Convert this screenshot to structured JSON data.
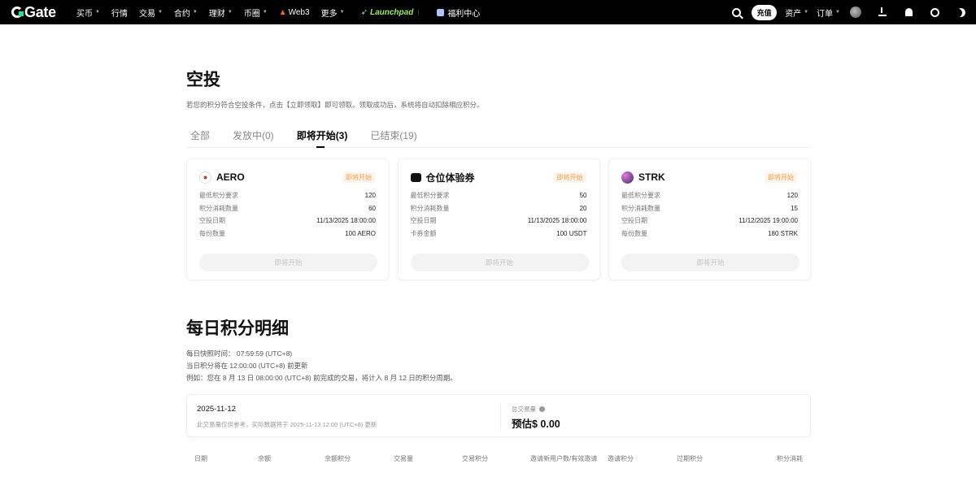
{
  "nav": {
    "logo": "Gate",
    "items": [
      {
        "label": "买币",
        "caret": true
      },
      {
        "label": "行情",
        "caret": false
      },
      {
        "label": "交易",
        "caret": true
      },
      {
        "label": "合约",
        "caret": true
      },
      {
        "label": "理财",
        "caret": true
      },
      {
        "label": "币圈",
        "caret": true
      },
      {
        "label": "Web3",
        "caret": false
      },
      {
        "label": "更多",
        "caret": true
      },
      {
        "label": "Launchpad",
        "caret": false
      },
      {
        "label": "福利中心",
        "caret": false
      }
    ],
    "deposit": "充值",
    "assets": "资产",
    "orders": "订单"
  },
  "page": {
    "title": "空投",
    "description": "若您的积分符合空投条件，点击【立即领取】即可领取。领取成功后，系统将自动扣除相应积分。",
    "tabs": [
      "全部",
      "发放中(0)",
      "即将开始(3)",
      "已结束(19)"
    ],
    "active_tab": 2
  },
  "cards": [
    {
      "name": "AERO",
      "badge": "即将开始",
      "rows": [
        {
          "k": "最低积分要求",
          "v": "120"
        },
        {
          "k": "积分消耗数量",
          "v": "60"
        },
        {
          "k": "空投日期",
          "v": "11/13/2025 18:00:00"
        },
        {
          "k": "每份数量",
          "v": "100 AERO"
        }
      ],
      "button": "即将开始"
    },
    {
      "name": "仓位体验券",
      "badge": "即将开始",
      "rows": [
        {
          "k": "最低积分要求",
          "v": "50"
        },
        {
          "k": "积分消耗数量",
          "v": "20"
        },
        {
          "k": "空投日期",
          "v": "11/13/2025 18:00:00"
        },
        {
          "k": "卡券金额",
          "v": "100 USDT"
        }
      ],
      "button": "即将开始"
    },
    {
      "name": "STRK",
      "badge": "即将开始",
      "rows": [
        {
          "k": "最低积分要求",
          "v": "120"
        },
        {
          "k": "积分消耗数量",
          "v": "15"
        },
        {
          "k": "空投日期",
          "v": "11/12/2025 19:00:00"
        },
        {
          "k": "每份数量",
          "v": "180 STRK"
        }
      ],
      "button": "即将开始"
    }
  ],
  "daily": {
    "title": "每日积分明细",
    "lines": [
      "每日快照时间：  07:59:59 (UTC+8)",
      "当日积分将在 12:00:00 (UTC+8) 前更新",
      "例如：您在 8 月 13 日 08:00:00 (UTC+8) 前完成的交易，将计入 8 月 12 日的积分周期。"
    ],
    "summary": {
      "date": "2025-11-12",
      "note": "此交易量仅供参考，实际数据将于 2025-11-13 12:00 (UTC+8) 更新",
      "volume_label": "总交易量",
      "volume_value": "预估$ 0.00"
    },
    "columns": [
      "日期",
      "余额",
      "余额积分",
      "交易量",
      "交易积分",
      "邀请新用户数/有效邀请",
      "邀请积分",
      "过期积分",
      "积分消耗"
    ]
  }
}
